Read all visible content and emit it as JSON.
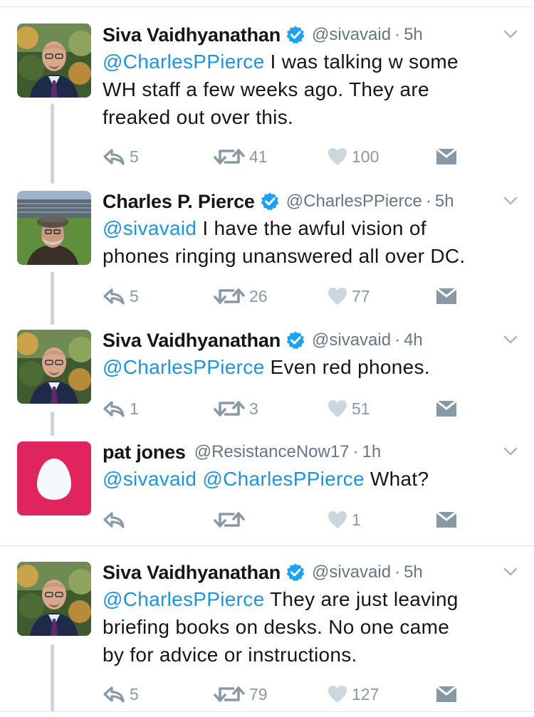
{
  "tweets": [
    {
      "name": "Siva Vaidhyanathan",
      "verified": true,
      "handle": "@sivavaid",
      "time": "5h",
      "mentions": "@CharlesPPierce",
      "body_line1": " I was talking w some",
      "body_line2": "WH staff a few weeks ago. They are",
      "body_line3": "freaked out over this.",
      "replies": "5",
      "retweets": "41",
      "likes": "100"
    },
    {
      "name": "Charles P. Pierce",
      "verified": true,
      "handle": "@CharlesPPierce",
      "time": "5h",
      "mentions": "@sivavaid",
      "body_line1": " I have the awful vision of",
      "body_line2": "phones ringing unanswered all over DC.",
      "replies": "5",
      "retweets": "26",
      "likes": "77"
    },
    {
      "name": "Siva Vaidhyanathan",
      "verified": true,
      "handle": "@sivavaid",
      "time": "4h",
      "mentions": "@CharlesPPierce",
      "body_line1": " Even red phones.",
      "replies": "1",
      "retweets": "3",
      "likes": "51"
    },
    {
      "name": "pat jones",
      "verified": false,
      "handle": "@ResistanceNow17",
      "time": "1h",
      "mention_a": "@sivavaid",
      "mention_b": "@CharlesPPierce",
      "body_line1": " What?",
      "replies": "",
      "retweets": "",
      "likes": "1"
    },
    {
      "name": "Siva Vaidhyanathan",
      "verified": true,
      "handle": "@sivavaid",
      "time": "5h",
      "mentions": "@CharlesPPierce",
      "body_line1": " They are just leaving",
      "body_line2": "briefing books on desks. No one came",
      "body_line3": "by for advice or instructions.",
      "replies": "5",
      "retweets": "79",
      "likes": "127"
    }
  ],
  "colors": {
    "mention": "#1b95e0",
    "verified": "#1da1f2",
    "muted": "#8899a6",
    "egg_background": "#e0245e",
    "thread_line": "#ccd6dd"
  },
  "icons": [
    "reply-icon",
    "retweet-icon",
    "like-icon",
    "direct-message-icon",
    "chevron-down-icon",
    "verified-badge-icon",
    "default-egg-avatar"
  ]
}
